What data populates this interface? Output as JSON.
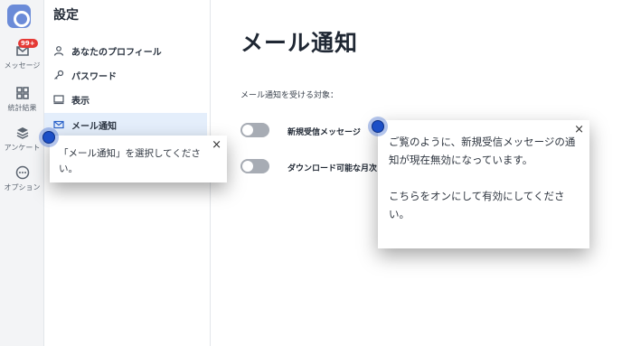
{
  "rail": {
    "badge": "99+",
    "items": [
      {
        "label": "メッセージ",
        "icon": "inbox-icon"
      },
      {
        "label": "統計結果",
        "icon": "grid-icon"
      },
      {
        "label": "アンケート",
        "icon": "layers-icon"
      },
      {
        "label": "オプション",
        "icon": "more-icon"
      }
    ]
  },
  "nav": {
    "title": "設定",
    "items": [
      {
        "label": "あなたのプロフィール",
        "icon": "user-icon"
      },
      {
        "label": "パスワード",
        "icon": "key-icon"
      },
      {
        "label": "表示",
        "icon": "monitor-icon"
      },
      {
        "label": "メール通知",
        "icon": "mail-icon",
        "active": true
      }
    ]
  },
  "main": {
    "title": "メール通知",
    "section_label": "メール通知を受ける対象：",
    "toggles": [
      {
        "label": "新規受信メッセージ",
        "on": false
      },
      {
        "label": "ダウンロード可能な月次",
        "on": false
      }
    ]
  },
  "tooltips": {
    "left": {
      "text": "「メール通知」を選択してください。",
      "close": "×"
    },
    "right": {
      "text": "ご覧のように、新規受信メッセージの通知が現在無効になっています。\n\nこちらをオンにして有効にしてください。",
      "close": "×"
    }
  },
  "colors": {
    "accent": "#1c4fc7",
    "active_nav_bg": "#e4eefb",
    "toggle_off": "#a7acb4",
    "logo": "#6b8bd8"
  }
}
